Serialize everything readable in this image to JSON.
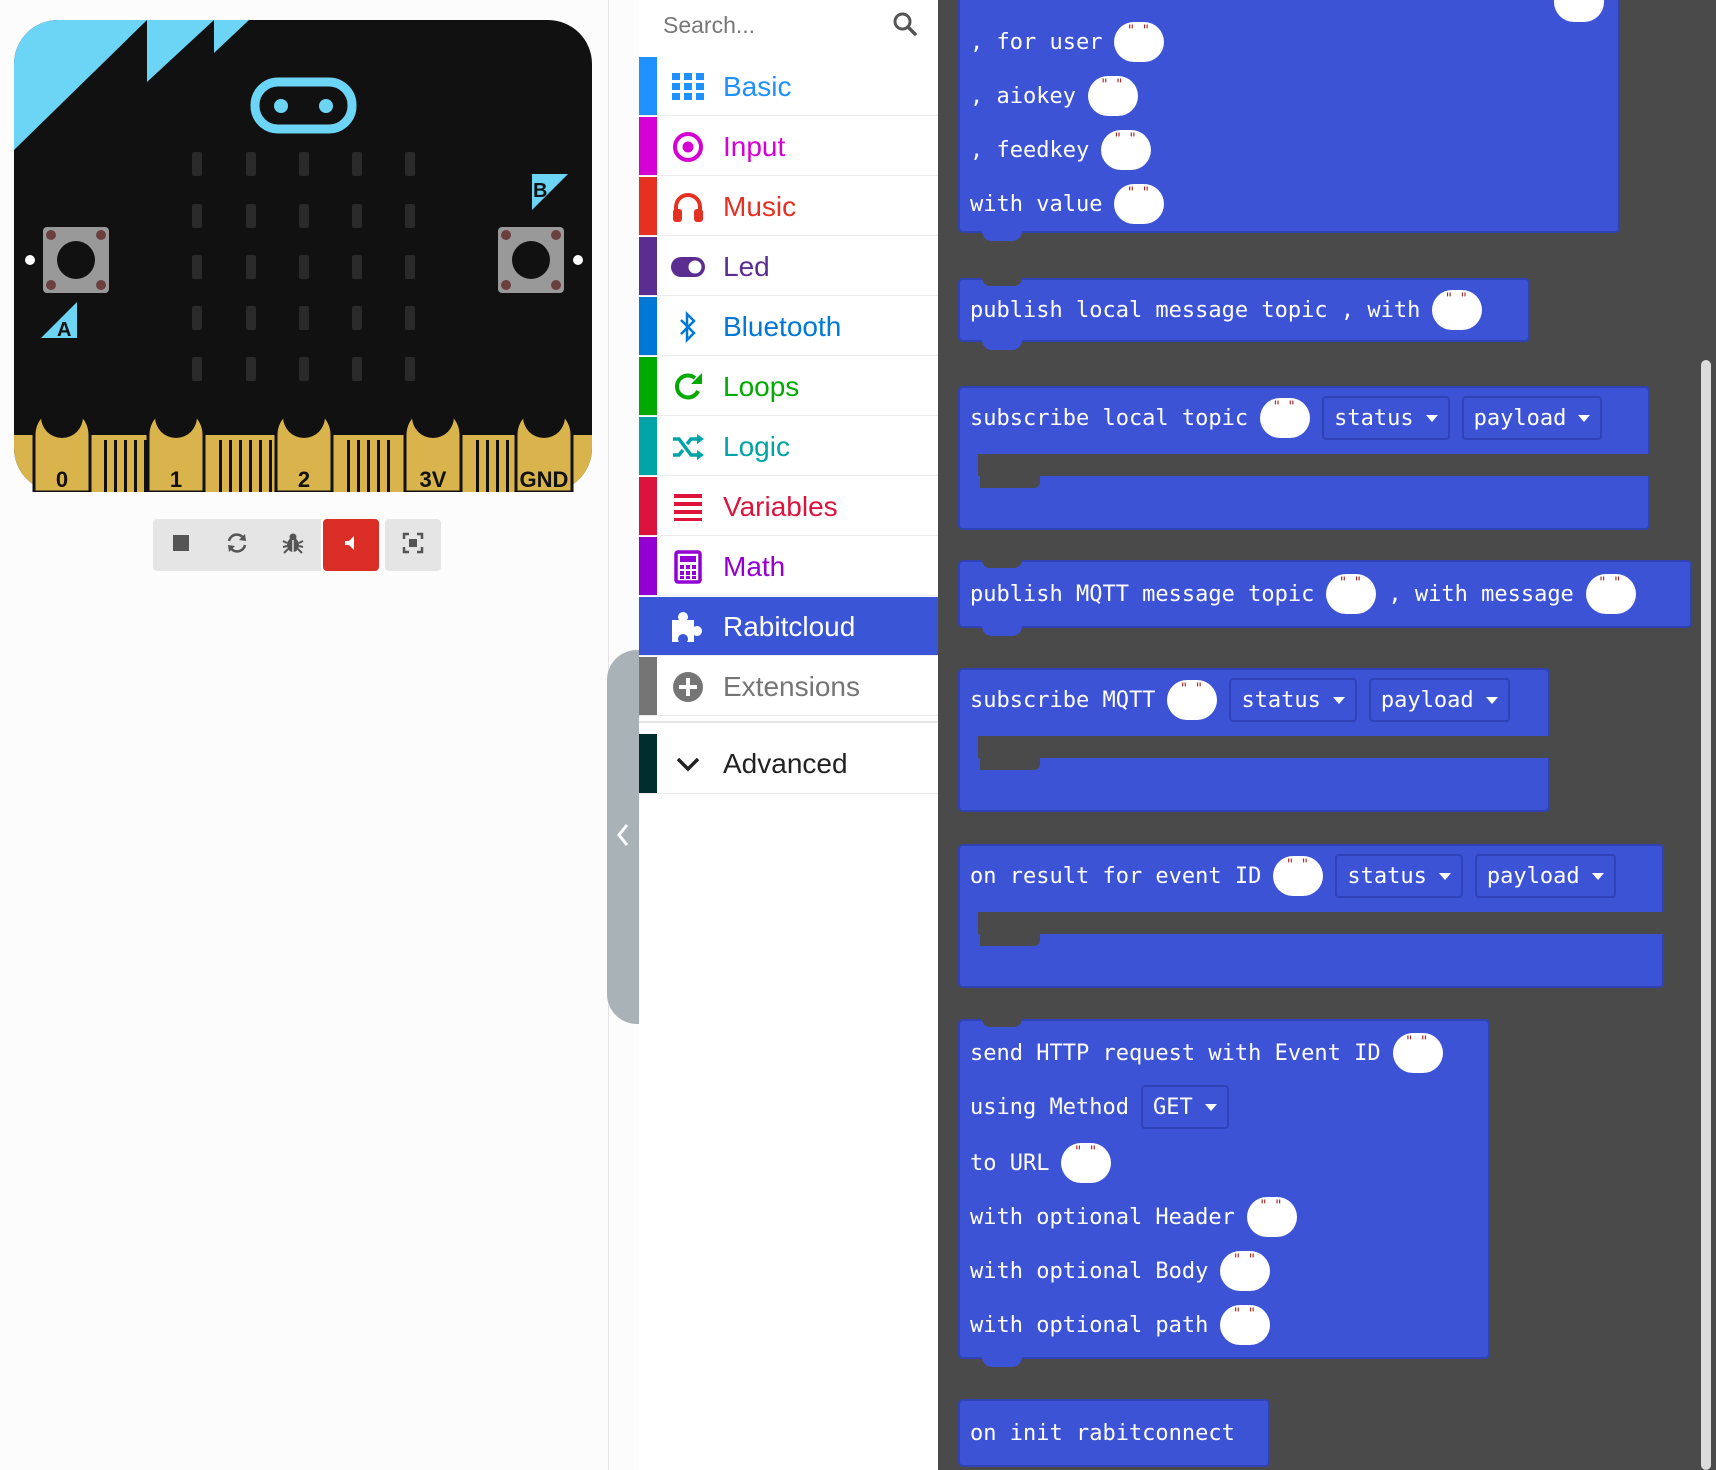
{
  "simulator": {
    "pins": [
      "0",
      "1",
      "2",
      "3V",
      "GND"
    ],
    "button_a": "A",
    "button_b": "B",
    "controls": [
      "stop-icon",
      "restart-icon",
      "debug-icon",
      "mute-icon",
      "fullscreen-icon"
    ]
  },
  "search": {
    "placeholder": "Search..."
  },
  "toolbox": {
    "categories": [
      {
        "label": "Basic",
        "color": "#1e90ff",
        "icon": "grid-icon"
      },
      {
        "label": "Input",
        "color": "#d400d4",
        "icon": "radio-icon"
      },
      {
        "label": "Music",
        "color": "#e63022",
        "icon": "headphones-icon"
      },
      {
        "label": "Led",
        "color": "#5c2d91",
        "icon": "toggle-icon"
      },
      {
        "label": "Bluetooth",
        "color": "#0078d7",
        "icon": "bluetooth-icon"
      },
      {
        "label": "Loops",
        "color": "#00aa00",
        "icon": "loop-icon"
      },
      {
        "label": "Logic",
        "color": "#00a4a6",
        "icon": "shuffle-icon"
      },
      {
        "label": "Variables",
        "color": "#dc143c",
        "icon": "list-icon"
      },
      {
        "label": "Math",
        "color": "#9400d3",
        "icon": "calculator-icon"
      },
      {
        "label": "Rabitcloud",
        "color": "#3a55d6",
        "icon": "puzzle-icon"
      },
      {
        "label": "Extensions",
        "color": "#757575",
        "icon": "plus-circle-icon"
      },
      {
        "label": "Advanced",
        "color": "#002e2e",
        "icon": "chevron-down-icon"
      }
    ]
  },
  "blocks": {
    "b1": {
      "r1": ", for user",
      "r2": ", aiokey",
      "r3": ", feedkey",
      "r4": "with value"
    },
    "b2": {
      "text": "publish local message topic , with"
    },
    "b3": {
      "text": "subscribe local topic",
      "dd1": "status",
      "dd2": "payload"
    },
    "b4": {
      "text1": "publish MQTT message topic",
      "text2": ", with message"
    },
    "b5": {
      "text": "subscribe MQTT",
      "dd1": "status",
      "dd2": "payload"
    },
    "b6": {
      "text": "on result for event ID",
      "dd1": "status",
      "dd2": "payload"
    },
    "b7": {
      "r1": "send HTTP request with Event ID",
      "r2": "using Method",
      "method": "GET",
      "r3": "to URL",
      "r4": "with optional Header",
      "r5": "with optional Body",
      "r6": "with optional path"
    },
    "b8": {
      "text": "on init rabitconnect"
    }
  }
}
